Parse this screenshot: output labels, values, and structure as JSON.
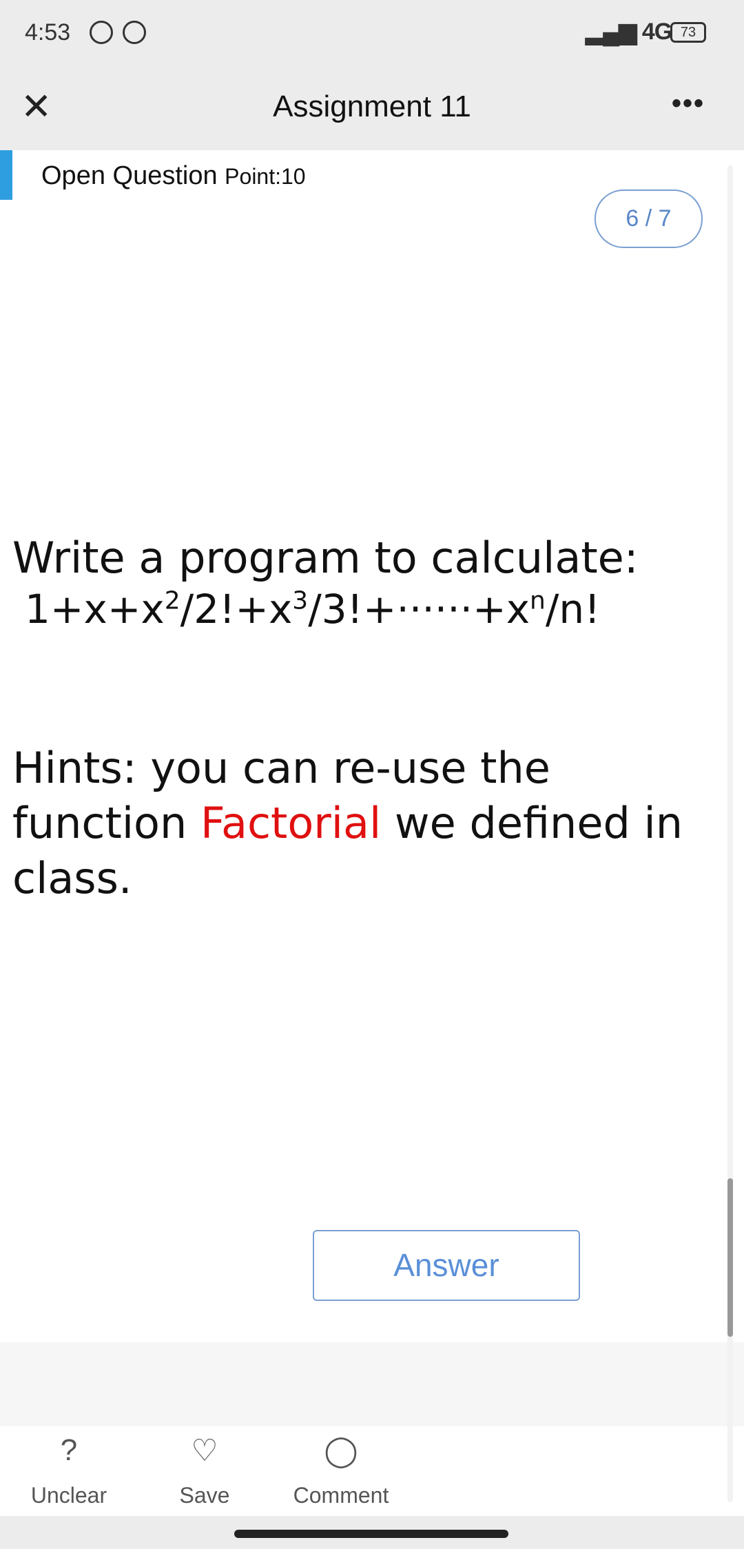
{
  "status_bar": {
    "time": "4:53",
    "network": "4G",
    "battery": "73"
  },
  "header": {
    "title": "Assignment 11",
    "close_icon": "close-icon",
    "more_icon": "more-icon"
  },
  "question": {
    "type": "Open Question",
    "points": "Point:10",
    "progress": "6 / 7",
    "prompt": "Write a program to calculate:",
    "formula": {
      "a": "1+x+x",
      "e1": "2",
      "b": "/2!+x",
      "e2": "3",
      "c": "/3!+······+x",
      "e3": "n",
      "d": "/n!"
    },
    "hint_before": "Hints: you can re-use the function ",
    "hint_highlight": "Factorial",
    "hint_after": " we defined in class.",
    "highlight_color": "#e01010"
  },
  "answer_label": "Answer",
  "bottom_bar": [
    {
      "label": "Unclear",
      "icon": "question-icon"
    },
    {
      "label": "Save",
      "icon": "heart-icon"
    },
    {
      "label": "Comment",
      "icon": "comment-icon"
    }
  ],
  "accent": "#2f9ee0"
}
